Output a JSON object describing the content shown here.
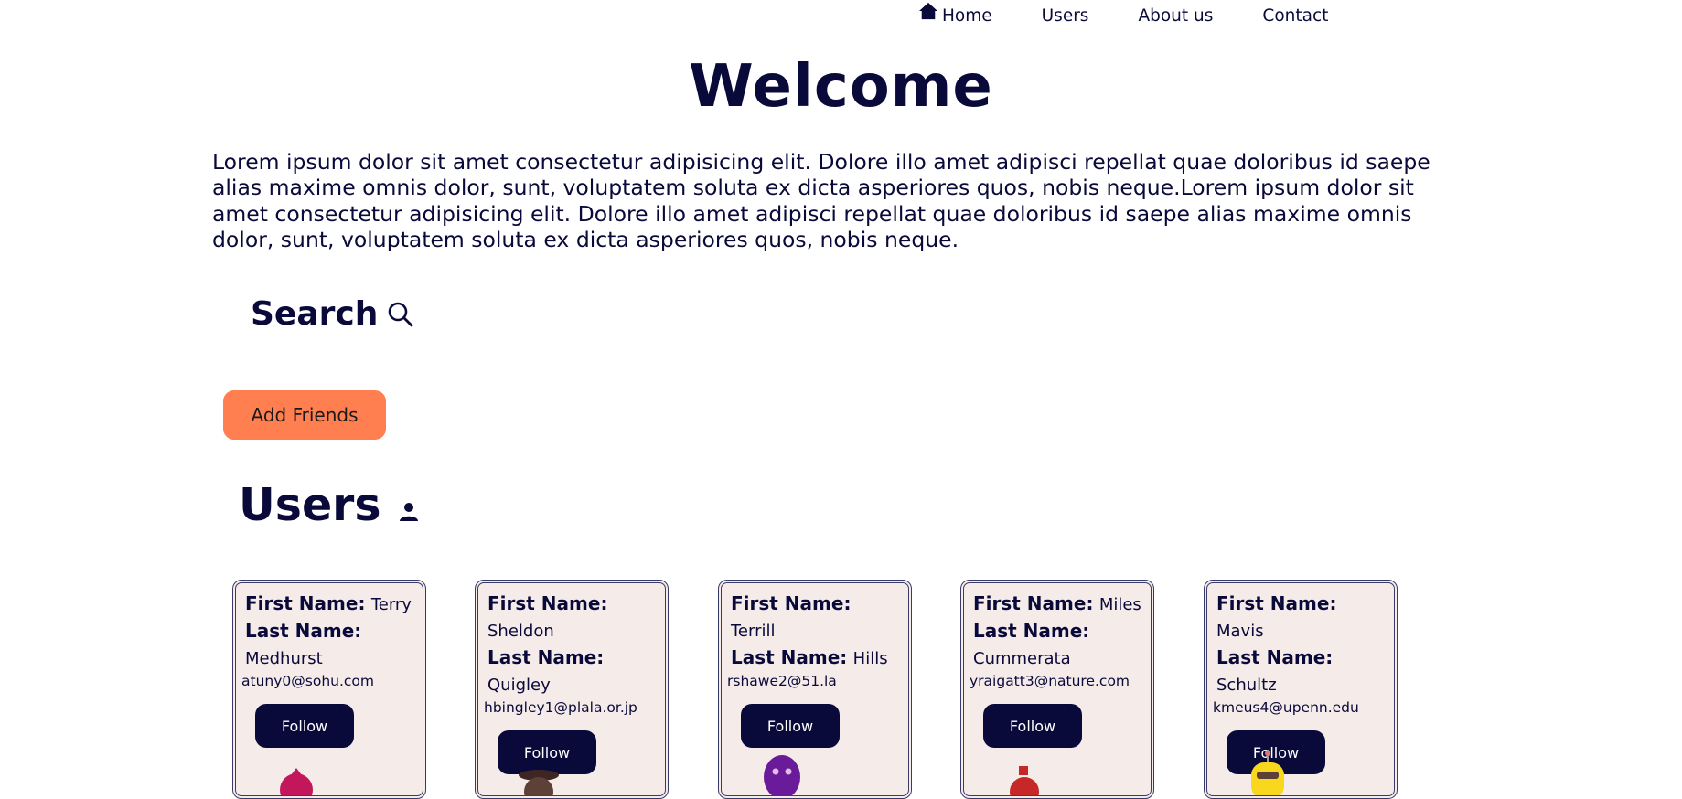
{
  "nav": {
    "items": [
      {
        "label": "Home",
        "icon": "home-icon"
      },
      {
        "label": "Users"
      },
      {
        "label": "About us"
      },
      {
        "label": "Contact"
      }
    ]
  },
  "hero": {
    "title": "Welcome",
    "text": "Lorem ipsum dolor sit amet consectetur adipisicing elit. Dolore illo amet adipisci repellat quae doloribus id saepe alias maxime omnis dolor, sunt, voluptatem soluta ex dicta asperiores quos, nobis neque.Lorem ipsum dolor sit amet consectetur adipisicing elit. Dolore illo amet adipisci repellat quae doloribus id saepe alias maxime omnis dolor, sunt, voluptatem soluta ex dicta asperiores quos, nobis neque."
  },
  "search": {
    "label": "Search",
    "icon": "search-icon"
  },
  "add_friends": {
    "label": "Add Friends"
  },
  "users": {
    "title": "Users",
    "icon": "user-icon",
    "first_label": "First Name:",
    "last_label": "Last Name:",
    "follow_label": "Follow",
    "list": [
      {
        "first": "Terry",
        "last": "Medhurst",
        "email": "atuny0@sohu.com",
        "avatar_color": "#c2185b"
      },
      {
        "first": "Sheldon",
        "last": "Quigley",
        "email": "hbingley1@plala.or.jp",
        "avatar_color": "#3e2723"
      },
      {
        "first": "Terrill",
        "last": "Hills",
        "email": "rshawe2@51.la",
        "avatar_color": "#6a1b9a"
      },
      {
        "first": "Miles",
        "last": "Cummerata",
        "email": "yraigatt3@nature.com",
        "avatar_color": "#c62828"
      },
      {
        "first": "Mavis",
        "last": "Schultz",
        "email": "kmeus4@upenn.edu",
        "avatar_color": "#f9d71c"
      }
    ]
  },
  "colors": {
    "primary": "#0a0a3a",
    "accent": "#ff7f50",
    "card_bg": "#f5ebe9"
  }
}
